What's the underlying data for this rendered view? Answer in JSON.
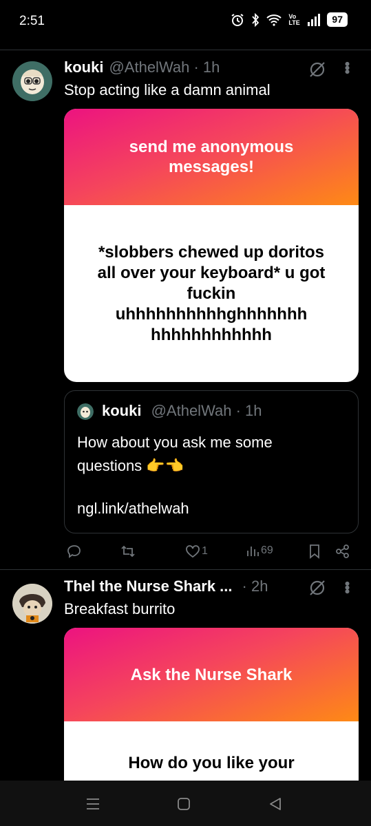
{
  "status": {
    "time": "2:51",
    "battery": "97",
    "volte": "Vo LTE"
  },
  "tweets": [
    {
      "name": "kouki",
      "handle": "@AthelWah · 1h",
      "text": "Stop acting like a damn animal",
      "card": {
        "header": "send me anonymous messages!",
        "message": "*slobbers chewed up doritos all over your keyboard* u got fuckin uhhhhhhhhhhghhhhhhh hhhhhhhhhhhh"
      },
      "quote": {
        "name": "kouki",
        "handle": "@AthelWah · 1h",
        "text": "How about you ask me some questions 👉👈",
        "link": "ngl.link/athelwah"
      },
      "actions": {
        "replies": "",
        "retweets": "",
        "likes": "1",
        "views": "69"
      }
    },
    {
      "name": "Thel the Nurse Shark ...",
      "handle": "· 2h",
      "text": "Breakfast burrito",
      "card": {
        "header": "Ask the Nurse Shark",
        "message": "How do you like your"
      }
    }
  ],
  "colors": {
    "background": "#000000",
    "muted": "#71767b",
    "ngl_pink": "#ec1380",
    "ngl_orange": "#fe8a15"
  },
  "icons": [
    "alarm-icon",
    "bluetooth-icon",
    "wifi-icon",
    "signal-icon",
    "battery-icon",
    "grok-icon",
    "more-icon",
    "reply-icon",
    "retweet-icon",
    "like-icon",
    "views-icon",
    "bookmark-icon",
    "share-icon",
    "nav-menu-icon",
    "nav-home-icon",
    "nav-back-icon"
  ]
}
